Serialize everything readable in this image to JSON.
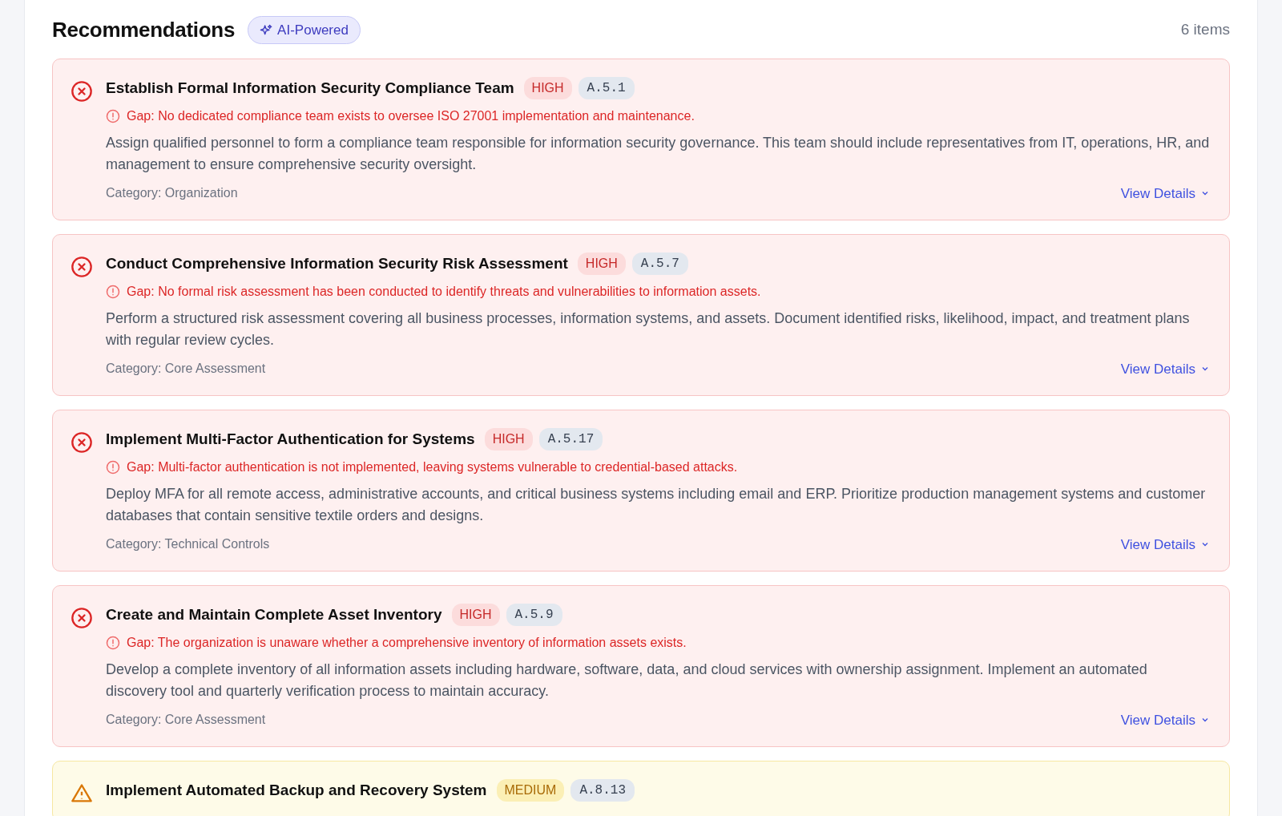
{
  "header": {
    "title": "Recommendations",
    "badge": "AI-Powered",
    "count": "6 items"
  },
  "recommendations": [
    {
      "kind": "high",
      "title": "Establish Formal Information Security Compliance Team",
      "priority": "HIGH",
      "control": "A.5.1",
      "gap": "Gap: No dedicated compliance team exists to oversee ISO 27001 implementation and maintenance.",
      "description": "Assign qualified personnel to form a compliance team responsible for information security governance. This team should include representatives from IT, operations, HR, and management to ensure comprehensive security oversight.",
      "category": "Category: Organization",
      "link": "View Details"
    },
    {
      "kind": "high",
      "title": "Conduct Comprehensive Information Security Risk Assessment",
      "priority": "HIGH",
      "control": "A.5.7",
      "gap": "Gap: No formal risk assessment has been conducted to identify threats and vulnerabilities to information assets.",
      "description": "Perform a structured risk assessment covering all business processes, information systems, and assets. Document identified risks, likelihood, impact, and treatment plans with regular review cycles.",
      "category": "Category: Core Assessment",
      "link": "View Details"
    },
    {
      "kind": "high",
      "title": "Implement Multi-Factor Authentication for Systems",
      "priority": "HIGH",
      "control": "A.5.17",
      "gap": "Gap: Multi-factor authentication is not implemented, leaving systems vulnerable to credential-based attacks.",
      "description": "Deploy MFA for all remote access, administrative accounts, and critical business systems including email and ERP. Prioritize production management systems and customer databases that contain sensitive textile orders and designs.",
      "category": "Category: Technical Controls",
      "link": "View Details"
    },
    {
      "kind": "high",
      "title": "Create and Maintain Complete Asset Inventory",
      "priority": "HIGH",
      "control": "A.5.9",
      "gap": "Gap: The organization is unaware whether a comprehensive inventory of information assets exists.",
      "description": "Develop a complete inventory of all information assets including hardware, software, data, and cloud services with ownership assignment. Implement an automated discovery tool and quarterly verification process to maintain accuracy.",
      "category": "Category: Core Assessment",
      "link": "View Details"
    },
    {
      "kind": "medium",
      "title": "Implement Automated Backup and Recovery System",
      "priority": "MEDIUM",
      "control": "A.8.13"
    }
  ]
}
